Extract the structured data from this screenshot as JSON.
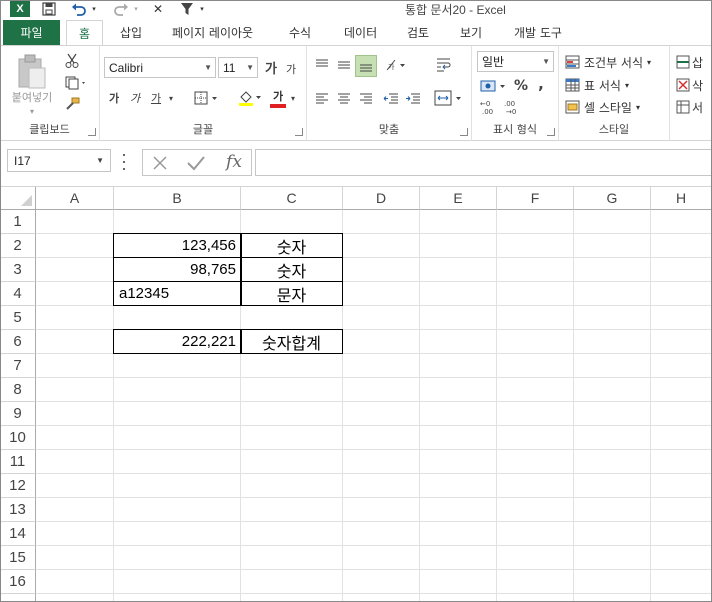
{
  "window": {
    "title": "통합 문서20 - Excel"
  },
  "qat": {
    "logo_text": "X",
    "save_icon": "save-icon",
    "undo_icon": "undo-icon",
    "redo_icon": "redo-icon",
    "close_glyph": "✕"
  },
  "tabs": {
    "file": "파일",
    "items": [
      "홈",
      "삽입",
      "페이지 레이아웃",
      "수식",
      "데이터",
      "검토",
      "보기",
      "개발 도구"
    ],
    "active": "홈"
  },
  "ribbon": {
    "clipboard": {
      "label": "클립보드",
      "paste": "붙여넣기"
    },
    "font": {
      "label": "글꼴",
      "font_name": "Calibri",
      "font_size": "11",
      "bold": "가",
      "italic": "가",
      "underline": "가",
      "grow": "가",
      "shrink": "가",
      "font_color_glyph": "가"
    },
    "alignment": {
      "label": "맞춤"
    },
    "number": {
      "label": "표시 형식",
      "format": "일반",
      "percent": "%",
      "comma": ","
    },
    "styles": {
      "label": "스타일",
      "conditional": "조건부 서식",
      "table": "표 서식",
      "cell_styles": "셀 스타일"
    },
    "cells": {
      "insert": "삽",
      "delete": "삭",
      "format": "서"
    }
  },
  "formula_bar": {
    "name_box": "I17",
    "fx": "fx",
    "value": ""
  },
  "sheet": {
    "columns": [
      "A",
      "B",
      "C",
      "D",
      "E",
      "F",
      "G",
      "H"
    ],
    "rows": [
      "1",
      "2",
      "3",
      "4",
      "5",
      "6",
      "7",
      "8",
      "9",
      "10",
      "11",
      "12",
      "13",
      "14",
      "15",
      "16"
    ],
    "cells": {
      "B2": "123,456",
      "C2": "숫자",
      "B3": "98,765",
      "C3": "숫자",
      "B4": "a12345",
      "C4": "문자",
      "B6": "222,221",
      "C6": "숫자합계"
    }
  }
}
